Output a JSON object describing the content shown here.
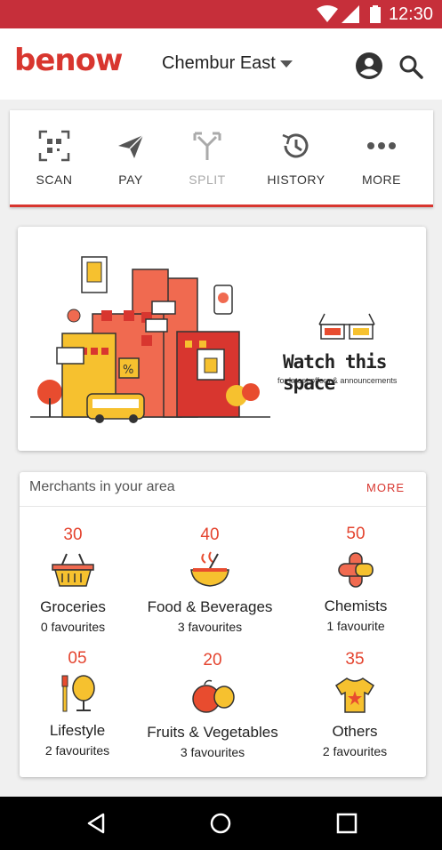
{
  "status": {
    "time": "12:30"
  },
  "header": {
    "brand": "benow",
    "location": "Chembur East"
  },
  "actions": [
    {
      "label": "SCAN",
      "icon": "scan-qr-icon",
      "enabled": true
    },
    {
      "label": "PAY",
      "icon": "send-icon",
      "enabled": true
    },
    {
      "label": "SPLIT",
      "icon": "split-icon",
      "enabled": false
    },
    {
      "label": "HISTORY",
      "icon": "history-icon",
      "enabled": true
    },
    {
      "label": "MORE",
      "icon": "more-dots-icon",
      "enabled": true
    }
  ],
  "banner": {
    "title": "Watch this space",
    "subtitle": "for latest offers & announcements"
  },
  "merchants": {
    "title": "Merchants in your area",
    "more_label": "MORE",
    "categories": [
      {
        "count": "30",
        "name": "Groceries",
        "favourites": "0 favourites",
        "icon": "basket-icon"
      },
      {
        "count": "40",
        "name": "Food & Beverages",
        "favourites": "3 favourites",
        "icon": "bowl-icon"
      },
      {
        "count": "50",
        "name": "Chemists",
        "favourites": "1 favourite",
        "icon": "pill-icon"
      },
      {
        "count": "05",
        "name": "Lifestyle",
        "favourites": "2 favourites",
        "icon": "mirror-brush-icon"
      },
      {
        "count": "20",
        "name": "Fruits & Vegetables",
        "favourites": "3 favourites",
        "icon": "fruits-icon"
      },
      {
        "count": "35",
        "name": "Others",
        "favourites": "2 favourites",
        "icon": "tshirt-icon"
      }
    ]
  },
  "colors": {
    "primary": "#d8362f",
    "statusbar": "#c62f3a",
    "accent_yellow": "#f6c12f"
  }
}
